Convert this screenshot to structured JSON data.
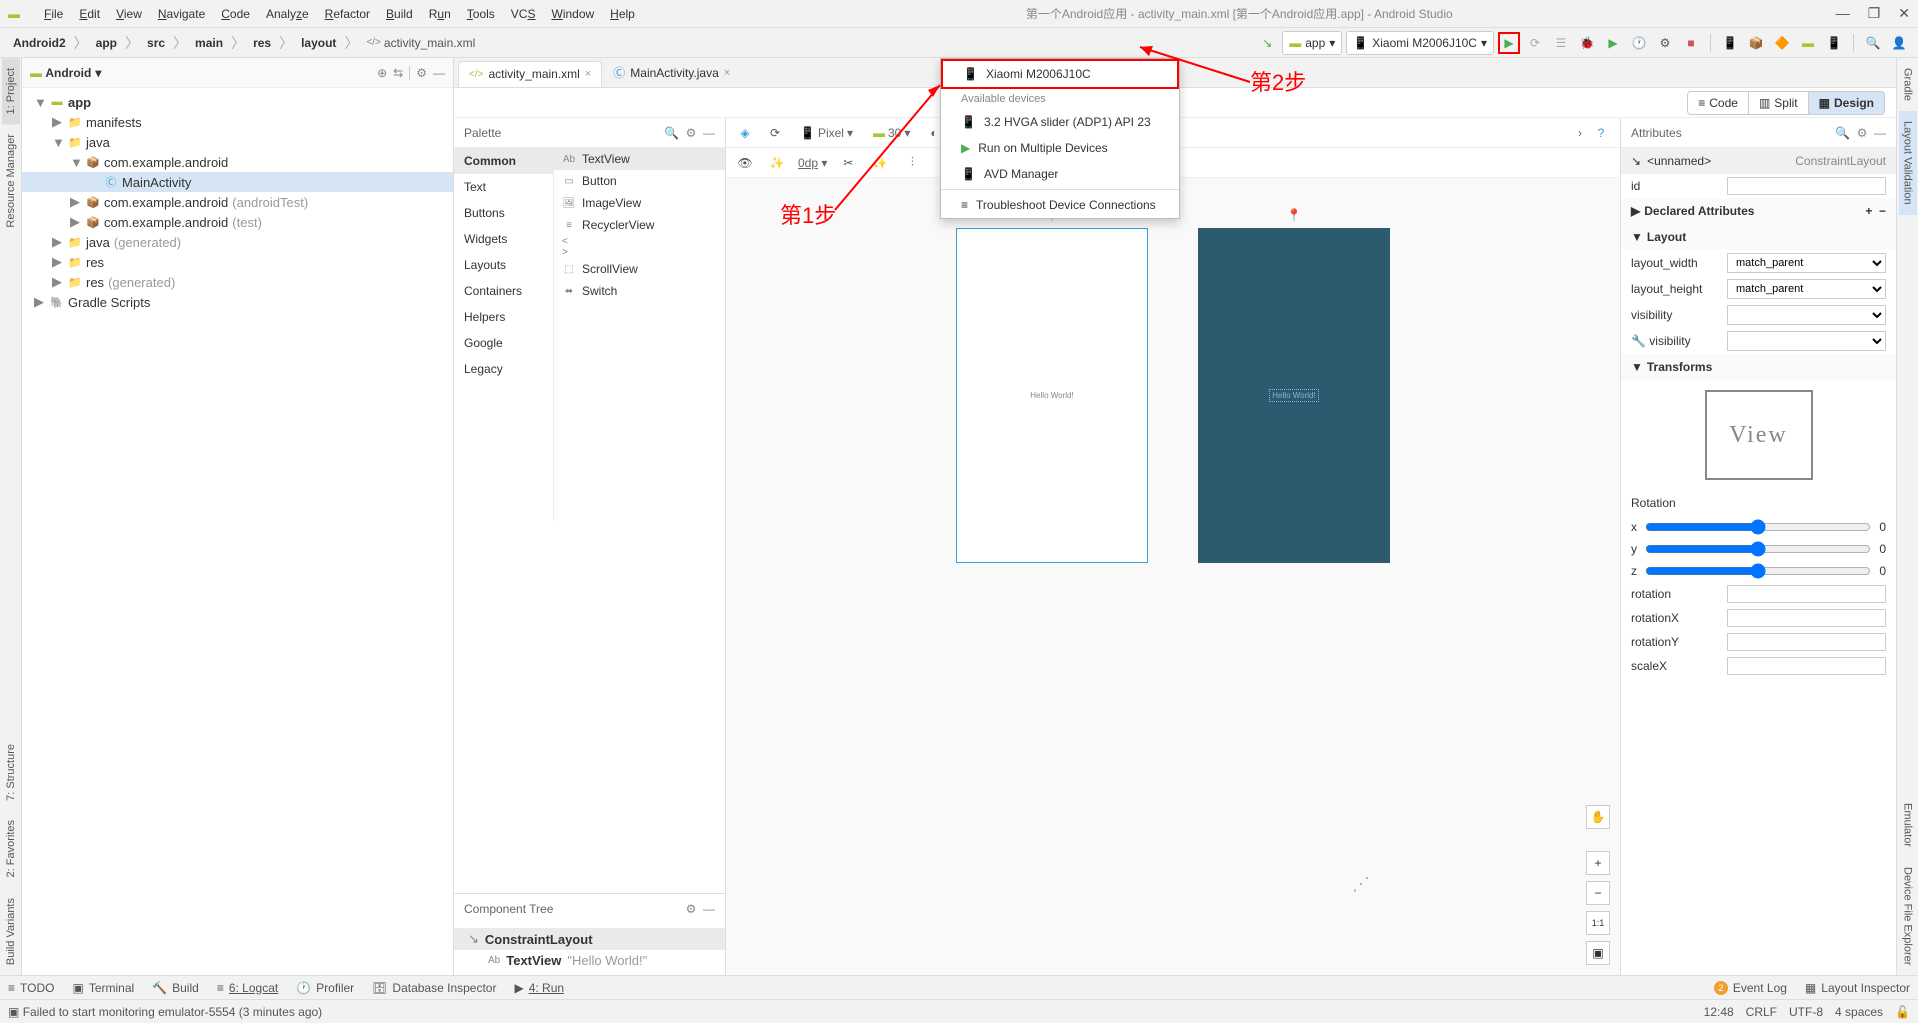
{
  "window_title": "第一个Android应用 - activity_main.xml [第一个Android应用.app] - Android Studio",
  "menu": [
    "File",
    "Edit",
    "View",
    "Navigate",
    "Code",
    "Analyze",
    "Refactor",
    "Build",
    "Run",
    "Tools",
    "VCS",
    "Window",
    "Help"
  ],
  "breadcrumbs": [
    "Android2",
    "app",
    "src",
    "main",
    "res",
    "layout"
  ],
  "breadcrumb_file": "activity_main.xml",
  "run_config": "app",
  "device_select": "Xiaomi M2006J10C",
  "project_panel": {
    "mode": "Android",
    "tree": [
      {
        "depth": 0,
        "icon": "app",
        "label": "app",
        "bold": true,
        "expand": "▼"
      },
      {
        "depth": 1,
        "icon": "folder",
        "label": "manifests",
        "expand": "▶"
      },
      {
        "depth": 1,
        "icon": "folder",
        "label": "java",
        "expand": "▼"
      },
      {
        "depth": 2,
        "icon": "pkg",
        "label": "com.example.android",
        "expand": "▼"
      },
      {
        "depth": 3,
        "icon": "class",
        "label": "MainActivity",
        "selected": true
      },
      {
        "depth": 2,
        "icon": "pkg",
        "label": "com.example.android",
        "suffix": " (androidTest)",
        "expand": "▶"
      },
      {
        "depth": 2,
        "icon": "pkg",
        "label": "com.example.android",
        "suffix": " (test)",
        "expand": "▶"
      },
      {
        "depth": 1,
        "icon": "folder",
        "label": "java",
        "suffix": " (generated)",
        "expand": "▶"
      },
      {
        "depth": 1,
        "icon": "folder",
        "label": "res",
        "expand": "▶"
      },
      {
        "depth": 1,
        "icon": "folder",
        "label": "res",
        "suffix": " (generated)",
        "expand": "▶"
      },
      {
        "depth": 0,
        "icon": "gradle",
        "label": "Gradle Scripts",
        "expand": "▶"
      }
    ]
  },
  "tabs": [
    {
      "label": "activity_main.xml",
      "icon": "xml",
      "active": true
    },
    {
      "label": "MainActivity.java",
      "icon": "class",
      "active": false
    }
  ],
  "palette": {
    "title": "Palette",
    "categories": [
      "Common",
      "Text",
      "Buttons",
      "Widgets",
      "Layouts",
      "Containers",
      "Helpers",
      "Google",
      "Legacy"
    ],
    "selected_category": "Common",
    "items": [
      "TextView",
      "Button",
      "ImageView",
      "RecyclerView",
      "<fragment>",
      "ScrollView",
      "Switch"
    ]
  },
  "component_tree": {
    "title": "Component Tree",
    "rows": [
      {
        "label": "ConstraintLayout",
        "selected": true
      },
      {
        "label": "TextView",
        "text": "\"Hello World!\""
      }
    ]
  },
  "design": {
    "device": "Pixel",
    "api": "30",
    "zoom": "0dp",
    "modes": [
      "Code",
      "Split",
      "Design"
    ],
    "active_mode": "Design",
    "hello": "Hello World!"
  },
  "device_dropdown": {
    "selected": "Xiaomi M2006J10C",
    "available_header": "Available devices",
    "items": [
      {
        "label": "3.2  HVGA slider (ADP1) API 23",
        "icon": "virtual"
      },
      {
        "label": "Run on Multiple Devices",
        "icon": "run"
      },
      {
        "label": "AVD Manager",
        "icon": "avd"
      }
    ],
    "troubleshoot": "Troubleshoot Device Connections"
  },
  "annotations": {
    "step1": "第1步",
    "step2": "第2步"
  },
  "attributes": {
    "title": "Attributes",
    "selected": "<unnamed>",
    "selected_type": "ConstraintLayout",
    "id_label": "id",
    "declared": "Declared Attributes",
    "layout": "Layout",
    "layout_width": "layout_width",
    "layout_width_val": "match_parent",
    "layout_height": "layout_height",
    "layout_height_val": "match_parent",
    "visibility": "visibility",
    "visibility2": "visibility",
    "transforms": "Transforms",
    "rotation": "Rotation",
    "axes": [
      "x",
      "y",
      "z"
    ],
    "axis_val": "0",
    "extra": [
      "rotation",
      "rotationX",
      "rotationY",
      "scaleX"
    ]
  },
  "bottom_tools": {
    "left": [
      "TODO",
      "Terminal",
      "Build",
      "6: Logcat",
      "Profiler",
      "Database Inspector",
      "4: Run"
    ],
    "right": [
      "Event Log",
      "Layout Inspector"
    ],
    "event_count": "2"
  },
  "status": {
    "msg": "Failed to start monitoring emulator-5554 (3 minutes ago)",
    "time": "12:48",
    "eol": "CRLF",
    "enc": "UTF-8",
    "indent": "4 spaces"
  },
  "left_tabs": [
    "1: Project",
    "Resource Manager"
  ],
  "left_tabs2": [
    "2: Favorites",
    "7: Structure"
  ],
  "left_tabs3": [
    "Build Variants"
  ],
  "right_tabs": [
    "Gradle",
    "Layout Validation"
  ],
  "right_tabs2": [
    "Emulator",
    "Device File Explorer"
  ]
}
